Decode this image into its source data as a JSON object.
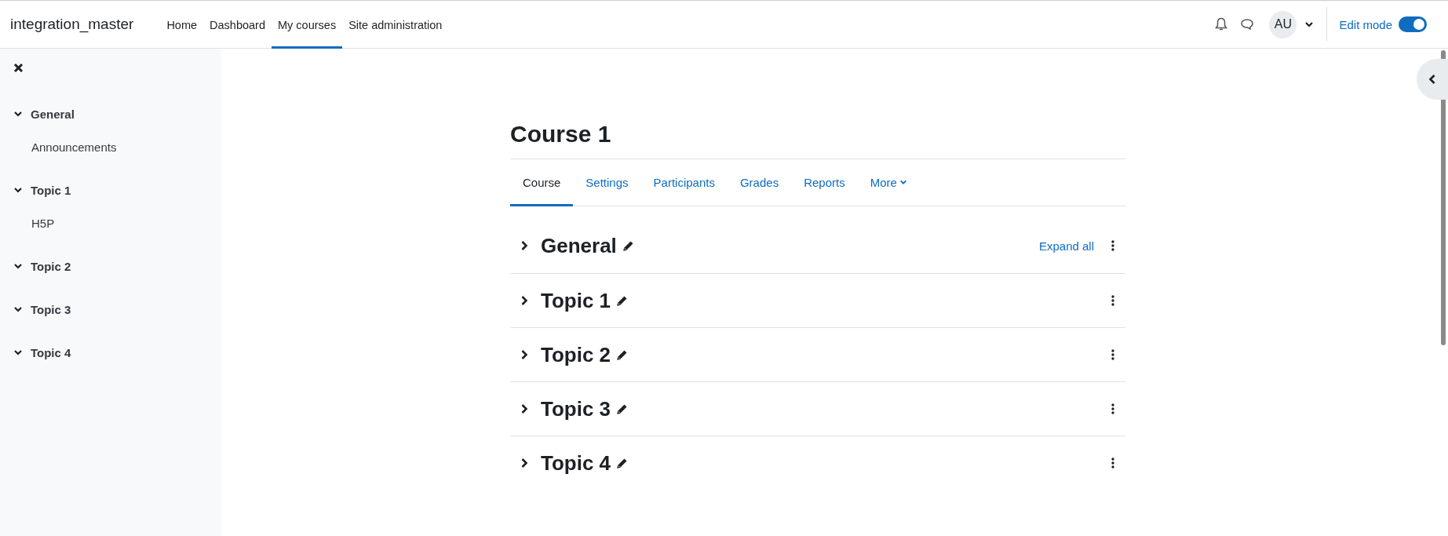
{
  "navbar": {
    "brand": "integration_master",
    "items": [
      {
        "label": "Home",
        "selected": false
      },
      {
        "label": "Dashboard",
        "selected": false
      },
      {
        "label": "My courses",
        "selected": true
      },
      {
        "label": "Site administration",
        "selected": false
      }
    ],
    "avatar": "AU",
    "edit_mode": {
      "label": "Edit mode",
      "on": true
    }
  },
  "course_index": {
    "sections": [
      {
        "title": "General",
        "expanded": true,
        "children": [
          {
            "title": "Announcements"
          }
        ]
      },
      {
        "title": "Topic 1",
        "expanded": true,
        "children": [
          {
            "title": "H5P"
          }
        ]
      },
      {
        "title": "Topic 2",
        "expanded": true
      },
      {
        "title": "Topic 3",
        "expanded": true
      },
      {
        "title": "Topic 4",
        "expanded": true
      }
    ]
  },
  "course": {
    "title": "Course 1",
    "tabs": [
      {
        "label": "Course",
        "selected": true,
        "kind": "link"
      },
      {
        "label": "Settings",
        "selected": false,
        "kind": "link"
      },
      {
        "label": "Participants",
        "selected": false,
        "kind": "link"
      },
      {
        "label": "Grades",
        "selected": false,
        "kind": "link"
      },
      {
        "label": "Reports",
        "selected": false,
        "kind": "link"
      },
      {
        "label": "More",
        "selected": false,
        "kind": "menu"
      }
    ],
    "expand_all": "Expand all",
    "sections": [
      {
        "title": "General",
        "expanded": false
      },
      {
        "title": "Topic 1",
        "expanded": false
      },
      {
        "title": "Topic 2",
        "expanded": false
      },
      {
        "title": "Topic 3",
        "expanded": false
      },
      {
        "title": "Topic 4",
        "expanded": false
      }
    ]
  }
}
